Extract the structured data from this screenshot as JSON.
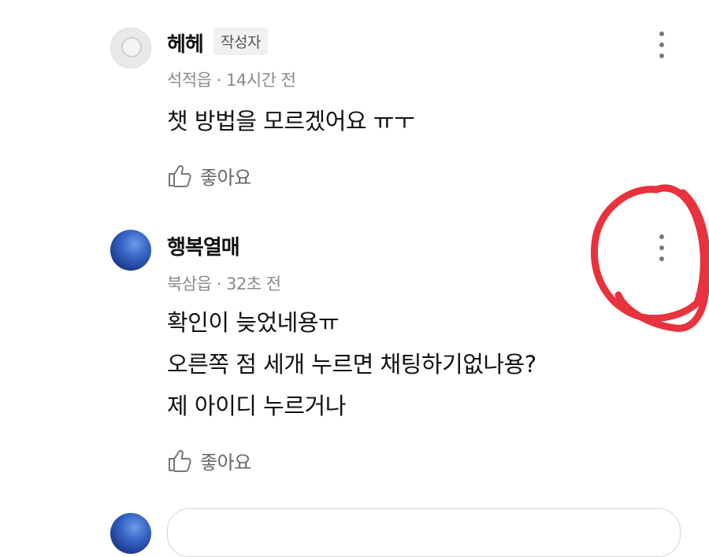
{
  "comments": [
    {
      "author": "헤헤",
      "badge": "작성자",
      "location": "석적읍",
      "time": "14시간 전",
      "lines": [
        "챗 방법을 모르겠어요 ㅠㅜ"
      ],
      "like_label": "좋아요",
      "avatar": "default-avatar"
    },
    {
      "author": "행복열매",
      "location": "북삼읍",
      "time": "32초 전",
      "lines": [
        "확인이 늦었네용ㅠ",
        "오른쪽 점 세개 누르면 채팅하기없나용?",
        "제 아이디 누르거나"
      ],
      "like_label": "좋아요",
      "avatar": "sky-avatar"
    }
  ],
  "meta_separator": "·",
  "colors": {
    "annotation": "#e8323d",
    "meta": "#8a8a8a"
  },
  "icons": {
    "more": "more-vertical-icon",
    "like": "thumbs-up-icon"
  }
}
